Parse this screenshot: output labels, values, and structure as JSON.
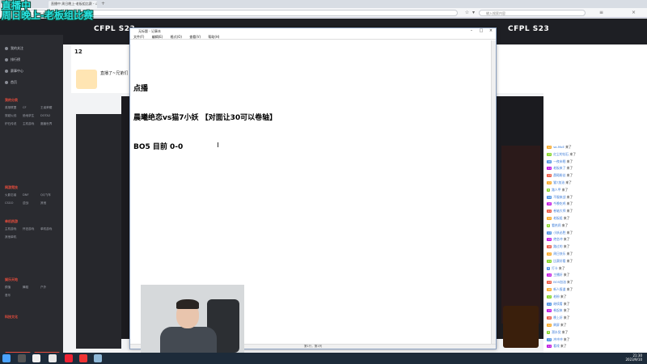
{
  "overlay": {
    "line1": "直播中",
    "line2": "周日晚上-老板组比赛"
  },
  "browser": {
    "tab_title": "直播中 周日晚上-老板组比赛 - 斗鱼",
    "url": "https://www.douyu.com/4615907?...",
    "search_placeholder": "输入搜索内容"
  },
  "site": {
    "logo_left": "CFPL S23",
    "logo_right": "CFPL S23",
    "follow_count": "12",
    "room_title": "直播了~兄弟们",
    "sidebar_top": [
      "我的关注",
      "排行榜",
      "赛事中心",
      "首页"
    ],
    "sidebar_group1": "我的分类",
    "sidebar_group1_items": [
      "英雄联盟",
      "CF",
      "王者荣耀",
      "穿越火线",
      "绝地求生",
      "DOTA2",
      "炉石传说",
      "主机游戏",
      "魔兽世界"
    ],
    "sidebar_group2": "网游竞技",
    "sidebar_group2_items": [
      "火影忍者",
      "DNF",
      "QQ飞车",
      "CSGO",
      "逆战",
      "其他"
    ],
    "sidebar_group3": "单机热游",
    "sidebar_group3_items": [
      "主机游戏",
      "怀旧游戏",
      "单机游戏",
      "其他单机"
    ],
    "sidebar_group4": "娱乐天地",
    "sidebar_group4_items": [
      "颜值",
      "舞蹈",
      "户外",
      "音乐"
    ],
    "sidebar_group5": "科技文化",
    "sidebar_btn1": "开播",
    "sidebar_btn2": "客户端"
  },
  "notepad": {
    "title": "无标题 - 记事本",
    "menu": [
      "文件(F)",
      "编辑(E)",
      "格式(O)",
      "查看(V)",
      "帮助(H)"
    ],
    "lines": [
      "点播",
      "晨曦绝恋vs猫7小妖 【对面让30可以卷轴】",
      "BO5 目前 0-0"
    ],
    "status": "第1行，第1列"
  },
  "chat": {
    "messages": [
      {
        "lvl": "12",
        "name": "sa-MoE",
        "msg": "来了"
      },
      {
        "lvl": "15",
        "name": "红尘的钻石",
        "msg": "来了"
      },
      {
        "lvl": "10",
        "name": "一夜未眠",
        "msg": "来了"
      },
      {
        "lvl": "11",
        "name": "老板来了",
        "msg": "来了"
      },
      {
        "lvl": "13",
        "name": "晨曦粉丝",
        "msg": "来了"
      },
      {
        "lvl": "12",
        "name": "猫7加油",
        "msg": "来了"
      },
      {
        "lvl": "9",
        "name": "路人甲",
        "msg": "来了"
      },
      {
        "lvl": "14",
        "name": "不服来战",
        "msg": "来了"
      },
      {
        "lvl": "10",
        "name": "今晚吃鸡",
        "msg": "来了"
      },
      {
        "lvl": "11",
        "name": "卷轴大师",
        "msg": "来了"
      },
      {
        "lvl": "12",
        "name": "老板组",
        "msg": "来了"
      },
      {
        "lvl": "8",
        "name": "看热闹",
        "msg": "来了"
      },
      {
        "lvl": "13",
        "name": "小妖必胜",
        "msg": "来了"
      },
      {
        "lvl": "15",
        "name": "绝恋冲",
        "msg": "来了"
      },
      {
        "lvl": "10",
        "name": "路过的",
        "msg": "来了"
      },
      {
        "lvl": "12",
        "name": "周日快乐",
        "msg": "来了"
      },
      {
        "lvl": "11",
        "name": "比赛好看",
        "msg": "来了"
      },
      {
        "lvl": "9",
        "name": "打卡",
        "msg": "来了"
      },
      {
        "lvl": "14",
        "name": "主播好",
        "msg": "来了"
      },
      {
        "lvl": "13",
        "name": "BO5加油",
        "msg": "来了"
      },
      {
        "lvl": "10",
        "name": "新人报道",
        "msg": "来了"
      },
      {
        "lvl": "12",
        "name": "老粉",
        "msg": "来了"
      },
      {
        "lvl": "11",
        "name": "继续看",
        "msg": "来了"
      },
      {
        "lvl": "15",
        "name": "卷起来",
        "msg": "来了"
      },
      {
        "lvl": "10",
        "name": "晚上好",
        "msg": "来了"
      },
      {
        "lvl": "12",
        "name": "刷屏",
        "msg": "来了"
      },
      {
        "lvl": "9",
        "name": "潜水党",
        "msg": "来了"
      },
      {
        "lvl": "13",
        "name": "冲冲冲",
        "msg": "来了"
      },
      {
        "lvl": "11",
        "name": "看戏",
        "msg": "来了"
      }
    ]
  },
  "taskbar": {
    "time": "21:30",
    "date": "2023/9/10"
  },
  "colors": {
    "overlay_text": "#29e3e0",
    "brand_red": "#e84d3d",
    "nav_dark": "#1e1f24"
  }
}
